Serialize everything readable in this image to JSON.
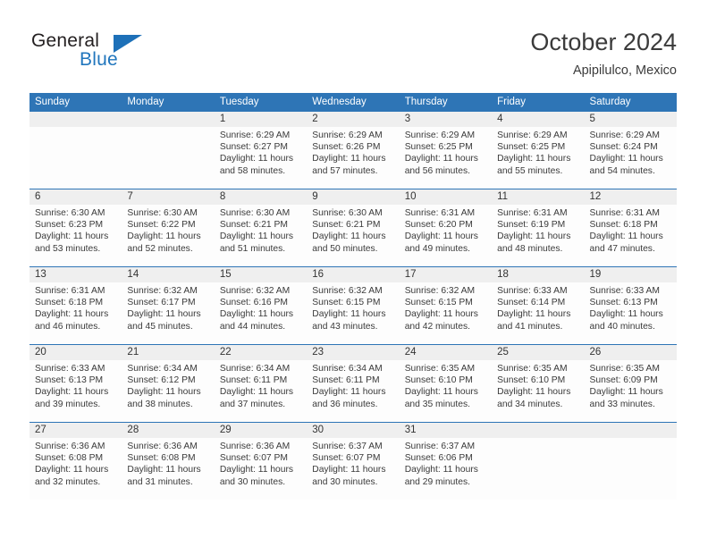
{
  "brand": {
    "name_top": "General",
    "name_bottom": "Blue",
    "triangle_color": "#1d70b8",
    "text_color": "#231f20",
    "blue_text_color": "#2176bd"
  },
  "header": {
    "title": "October 2024",
    "subtitle": "Apipilulco, Mexico"
  },
  "theme": {
    "header_bg": "#2e75b6",
    "header_text": "#ffffff",
    "daynum_bg": "#efefef",
    "cell_bg": "#fdfdfd",
    "week_rule": "#2e75b6"
  },
  "weekdays": [
    "Sunday",
    "Monday",
    "Tuesday",
    "Wednesday",
    "Thursday",
    "Friday",
    "Saturday"
  ],
  "labels": {
    "sunrise": "Sunrise:",
    "sunset": "Sunset:",
    "daylight": "Daylight:"
  },
  "weeks": [
    [
      {
        "day": "",
        "sunrise": "",
        "sunset": "",
        "daylight": ""
      },
      {
        "day": "",
        "sunrise": "",
        "sunset": "",
        "daylight": ""
      },
      {
        "day": "1",
        "sunrise": "Sunrise: 6:29 AM",
        "sunset": "Sunset: 6:27 PM",
        "daylight": "Daylight: 11 hours and 58 minutes."
      },
      {
        "day": "2",
        "sunrise": "Sunrise: 6:29 AM",
        "sunset": "Sunset: 6:26 PM",
        "daylight": "Daylight: 11 hours and 57 minutes."
      },
      {
        "day": "3",
        "sunrise": "Sunrise: 6:29 AM",
        "sunset": "Sunset: 6:25 PM",
        "daylight": "Daylight: 11 hours and 56 minutes."
      },
      {
        "day": "4",
        "sunrise": "Sunrise: 6:29 AM",
        "sunset": "Sunset: 6:25 PM",
        "daylight": "Daylight: 11 hours and 55 minutes."
      },
      {
        "day": "5",
        "sunrise": "Sunrise: 6:29 AM",
        "sunset": "Sunset: 6:24 PM",
        "daylight": "Daylight: 11 hours and 54 minutes."
      }
    ],
    [
      {
        "day": "6",
        "sunrise": "Sunrise: 6:30 AM",
        "sunset": "Sunset: 6:23 PM",
        "daylight": "Daylight: 11 hours and 53 minutes."
      },
      {
        "day": "7",
        "sunrise": "Sunrise: 6:30 AM",
        "sunset": "Sunset: 6:22 PM",
        "daylight": "Daylight: 11 hours and 52 minutes."
      },
      {
        "day": "8",
        "sunrise": "Sunrise: 6:30 AM",
        "sunset": "Sunset: 6:21 PM",
        "daylight": "Daylight: 11 hours and 51 minutes."
      },
      {
        "day": "9",
        "sunrise": "Sunrise: 6:30 AM",
        "sunset": "Sunset: 6:21 PM",
        "daylight": "Daylight: 11 hours and 50 minutes."
      },
      {
        "day": "10",
        "sunrise": "Sunrise: 6:31 AM",
        "sunset": "Sunset: 6:20 PM",
        "daylight": "Daylight: 11 hours and 49 minutes."
      },
      {
        "day": "11",
        "sunrise": "Sunrise: 6:31 AM",
        "sunset": "Sunset: 6:19 PM",
        "daylight": "Daylight: 11 hours and 48 minutes."
      },
      {
        "day": "12",
        "sunrise": "Sunrise: 6:31 AM",
        "sunset": "Sunset: 6:18 PM",
        "daylight": "Daylight: 11 hours and 47 minutes."
      }
    ],
    [
      {
        "day": "13",
        "sunrise": "Sunrise: 6:31 AM",
        "sunset": "Sunset: 6:18 PM",
        "daylight": "Daylight: 11 hours and 46 minutes."
      },
      {
        "day": "14",
        "sunrise": "Sunrise: 6:32 AM",
        "sunset": "Sunset: 6:17 PM",
        "daylight": "Daylight: 11 hours and 45 minutes."
      },
      {
        "day": "15",
        "sunrise": "Sunrise: 6:32 AM",
        "sunset": "Sunset: 6:16 PM",
        "daylight": "Daylight: 11 hours and 44 minutes."
      },
      {
        "day": "16",
        "sunrise": "Sunrise: 6:32 AM",
        "sunset": "Sunset: 6:15 PM",
        "daylight": "Daylight: 11 hours and 43 minutes."
      },
      {
        "day": "17",
        "sunrise": "Sunrise: 6:32 AM",
        "sunset": "Sunset: 6:15 PM",
        "daylight": "Daylight: 11 hours and 42 minutes."
      },
      {
        "day": "18",
        "sunrise": "Sunrise: 6:33 AM",
        "sunset": "Sunset: 6:14 PM",
        "daylight": "Daylight: 11 hours and 41 minutes."
      },
      {
        "day": "19",
        "sunrise": "Sunrise: 6:33 AM",
        "sunset": "Sunset: 6:13 PM",
        "daylight": "Daylight: 11 hours and 40 minutes."
      }
    ],
    [
      {
        "day": "20",
        "sunrise": "Sunrise: 6:33 AM",
        "sunset": "Sunset: 6:13 PM",
        "daylight": "Daylight: 11 hours and 39 minutes."
      },
      {
        "day": "21",
        "sunrise": "Sunrise: 6:34 AM",
        "sunset": "Sunset: 6:12 PM",
        "daylight": "Daylight: 11 hours and 38 minutes."
      },
      {
        "day": "22",
        "sunrise": "Sunrise: 6:34 AM",
        "sunset": "Sunset: 6:11 PM",
        "daylight": "Daylight: 11 hours and 37 minutes."
      },
      {
        "day": "23",
        "sunrise": "Sunrise: 6:34 AM",
        "sunset": "Sunset: 6:11 PM",
        "daylight": "Daylight: 11 hours and 36 minutes."
      },
      {
        "day": "24",
        "sunrise": "Sunrise: 6:35 AM",
        "sunset": "Sunset: 6:10 PM",
        "daylight": "Daylight: 11 hours and 35 minutes."
      },
      {
        "day": "25",
        "sunrise": "Sunrise: 6:35 AM",
        "sunset": "Sunset: 6:10 PM",
        "daylight": "Daylight: 11 hours and 34 minutes."
      },
      {
        "day": "26",
        "sunrise": "Sunrise: 6:35 AM",
        "sunset": "Sunset: 6:09 PM",
        "daylight": "Daylight: 11 hours and 33 minutes."
      }
    ],
    [
      {
        "day": "27",
        "sunrise": "Sunrise: 6:36 AM",
        "sunset": "Sunset: 6:08 PM",
        "daylight": "Daylight: 11 hours and 32 minutes."
      },
      {
        "day": "28",
        "sunrise": "Sunrise: 6:36 AM",
        "sunset": "Sunset: 6:08 PM",
        "daylight": "Daylight: 11 hours and 31 minutes."
      },
      {
        "day": "29",
        "sunrise": "Sunrise: 6:36 AM",
        "sunset": "Sunset: 6:07 PM",
        "daylight": "Daylight: 11 hours and 30 minutes."
      },
      {
        "day": "30",
        "sunrise": "Sunrise: 6:37 AM",
        "sunset": "Sunset: 6:07 PM",
        "daylight": "Daylight: 11 hours and 30 minutes."
      },
      {
        "day": "31",
        "sunrise": "Sunrise: 6:37 AM",
        "sunset": "Sunset: 6:06 PM",
        "daylight": "Daylight: 11 hours and 29 minutes."
      },
      {
        "day": "",
        "sunrise": "",
        "sunset": "",
        "daylight": ""
      },
      {
        "day": "",
        "sunrise": "",
        "sunset": "",
        "daylight": ""
      }
    ]
  ]
}
